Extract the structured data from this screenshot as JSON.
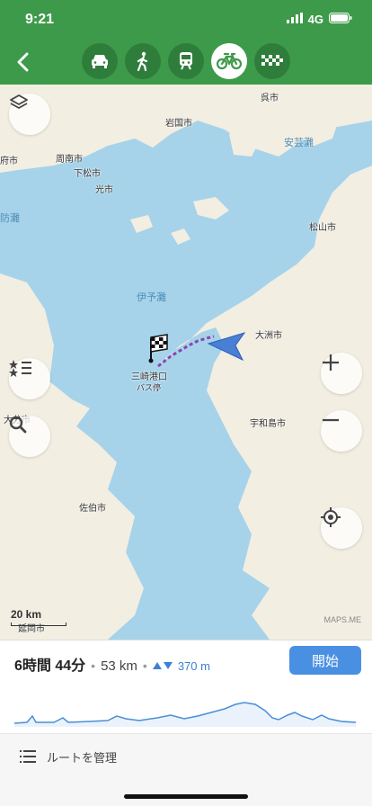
{
  "status": {
    "time": "9:21",
    "network": "4G"
  },
  "nav": {
    "modes": [
      {
        "name": "car",
        "active": false
      },
      {
        "name": "walk",
        "active": false
      },
      {
        "name": "transit",
        "active": false
      },
      {
        "name": "bicycle",
        "active": true
      },
      {
        "name": "taxi",
        "active": false
      }
    ]
  },
  "map": {
    "places": [
      "呉市",
      "岩国市",
      "周南市",
      "下松市",
      "光市",
      "府市",
      "松山市",
      "大洲市",
      "宇和島市",
      "大分市",
      "佐伯市",
      "延岡市"
    ],
    "seas": [
      "安芸灘",
      "伊予灘",
      "防灘"
    ],
    "destination": {
      "name": "三崎港口",
      "subtitle": "バス停"
    },
    "scale": "20 km",
    "attribution": "MAPS.ME"
  },
  "route": {
    "duration": "6時間 44分",
    "separator": "•",
    "distance": "53 km",
    "elevation": "370 m",
    "start_label": "開始"
  },
  "manage": {
    "label": "ルートを管理"
  },
  "colors": {
    "header": "#3d9a4a",
    "sea": "#a6d3ea",
    "land": "#f2eee2",
    "route": "#8e44ad",
    "accent": "#4a90e2"
  }
}
